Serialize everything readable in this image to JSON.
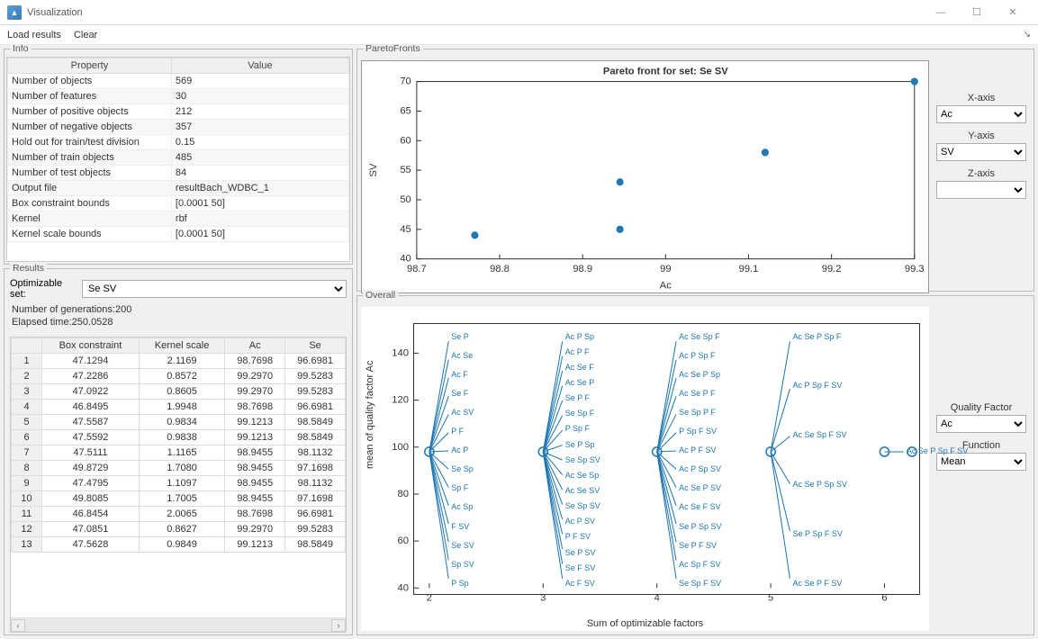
{
  "window": {
    "title": "Visualization"
  },
  "menu": {
    "load": "Load results",
    "clear": "Clear"
  },
  "panels": {
    "info": "Info",
    "results": "Results",
    "pareto": "ParetoFronts",
    "overall": "Overall"
  },
  "info_header": {
    "prop": "Property",
    "val": "Value"
  },
  "info_rows": [
    {
      "p": "Number of objects",
      "v": "569"
    },
    {
      "p": "Number of features",
      "v": "30"
    },
    {
      "p": "Number of positive objects",
      "v": "212"
    },
    {
      "p": "Number of negative objects",
      "v": "357"
    },
    {
      "p": "Hold out for train/test division",
      "v": "0.15"
    },
    {
      "p": "Number of train objects",
      "v": "485"
    },
    {
      "p": "Number of test objects",
      "v": "84"
    },
    {
      "p": "Output file",
      "v": "resultBach_WDBC_1"
    },
    {
      "p": "Box constraint bounds",
      "v": "[0.0001 50]"
    },
    {
      "p": "Kernel",
      "v": "rbf"
    },
    {
      "p": "Kernel scale bounds",
      "v": "[0.0001 50]"
    }
  ],
  "results": {
    "opt_label": "Optimizable set:",
    "opt_value": "Se SV",
    "ngen_label": "Number of generations:",
    "ngen": "200",
    "elapsed_label": "Elapsed time:",
    "elapsed": "250.0528",
    "cols": [
      "Box constraint",
      "Kernel scale",
      "Ac",
      "Se"
    ],
    "rows": [
      {
        "n": "1",
        "c": [
          "47.1294",
          "2.1169",
          "98.7698",
          "96.6981"
        ]
      },
      {
        "n": "2",
        "c": [
          "47.2286",
          "0.8572",
          "99.2970",
          "99.5283"
        ]
      },
      {
        "n": "3",
        "c": [
          "47.0922",
          "0.8605",
          "99.2970",
          "99.5283"
        ]
      },
      {
        "n": "4",
        "c": [
          "46.8495",
          "1.9948",
          "98.7698",
          "96.6981"
        ]
      },
      {
        "n": "5",
        "c": [
          "47.5587",
          "0.9834",
          "99.1213",
          "98.5849"
        ]
      },
      {
        "n": "6",
        "c": [
          "47.5592",
          "0.9838",
          "99.1213",
          "98.5849"
        ]
      },
      {
        "n": "7",
        "c": [
          "47.5111",
          "1.1165",
          "98.9455",
          "98.1132"
        ]
      },
      {
        "n": "8",
        "c": [
          "49.8729",
          "1.7080",
          "98.9455",
          "97.1698"
        ]
      },
      {
        "n": "9",
        "c": [
          "47.4795",
          "1.1097",
          "98.9455",
          "98.1132"
        ]
      },
      {
        "n": "10",
        "c": [
          "49.8085",
          "1.7005",
          "98.9455",
          "97.1698"
        ]
      },
      {
        "n": "11",
        "c": [
          "46.8454",
          "2.0065",
          "98.7698",
          "96.6981"
        ]
      },
      {
        "n": "12",
        "c": [
          "47.0851",
          "0.8627",
          "99.2970",
          "99.5283"
        ]
      },
      {
        "n": "13",
        "c": [
          "47.5628",
          "0.9849",
          "99.1213",
          "98.5849"
        ]
      }
    ]
  },
  "pareto": {
    "x_label": "X-axis",
    "x_val": "Ac",
    "y_label": "Y-axis",
    "y_val": "SV",
    "z_label": "Z-axis",
    "z_val": ""
  },
  "chart_data": {
    "type": "scatter",
    "title": "Pareto front for set: Se SV",
    "xlabel": "Ac",
    "ylabel": "SV",
    "xlim": [
      98.7,
      99.3
    ],
    "ylim": [
      40,
      70
    ],
    "xticks": [
      98.7,
      98.8,
      98.9,
      99,
      99.1,
      99.2,
      99.3
    ],
    "yticks": [
      40,
      45,
      50,
      55,
      60,
      65,
      70
    ],
    "points": [
      {
        "x": 98.77,
        "y": 44
      },
      {
        "x": 98.945,
        "y": 45
      },
      {
        "x": 98.945,
        "y": 53
      },
      {
        "x": 99.12,
        "y": 58
      },
      {
        "x": 99.3,
        "y": 70
      }
    ]
  },
  "overall": {
    "xlabel": "Sum of optimizable factors",
    "ylabel": "mean of quality factor Ac",
    "qf_label": "Quality Factor",
    "qf_val": "Ac",
    "fn_label": "Function",
    "fn_val": "Mean",
    "xticks": [
      2,
      3,
      4,
      5,
      6
    ],
    "ylim": [
      40,
      150
    ],
    "yticks": [
      40,
      60,
      80,
      100,
      120,
      140
    ],
    "columns": [
      {
        "x": 2,
        "labels": [
          "Se P",
          "Ac Se",
          "Ac F",
          "Se F",
          "Ac SV",
          "P F",
          "Ac P",
          "Se Sp",
          "Sp F",
          "Ac Sp",
          "F SV",
          "Se SV",
          "Sp SV",
          "P Sp"
        ]
      },
      {
        "x": 3,
        "labels": [
          "Ac P Sp",
          "Ac P F",
          "Ac Se F",
          "Ac Se P",
          "Se P F",
          "Se Sp F",
          "P Sp F",
          "Se P Sp",
          "Se Sp SV",
          "Ac Se Sp",
          "Ac Se SV",
          "Se Sp SV",
          "Ac P SV",
          "P F SV",
          "Se P SV",
          "Se F SV",
          "Ac F SV"
        ]
      },
      {
        "x": 4,
        "labels": [
          "Ac Se Sp F",
          "Ac P Sp F",
          "Ac Se P Sp",
          "Ac Se P F",
          "Se Sp P F",
          "P Sp F SV",
          "Ac P F SV",
          "Ac P Sp SV",
          "Ac Se P SV",
          "Ac Se F SV",
          "Se P Sp SV",
          "Se P F SV",
          "Ac Sp F SV",
          "Se Sp F SV"
        ]
      },
      {
        "x": 5,
        "labels": [
          "Ac Se P Sp F",
          "Ac P Sp F SV",
          "Ac Se Sp F SV",
          "Ac Se P Sp SV",
          "Se P Sp F SV",
          "Ac Se P F SV"
        ]
      },
      {
        "x": 6,
        "labels": [
          "Ac Se P Sp F SV"
        ]
      }
    ]
  }
}
